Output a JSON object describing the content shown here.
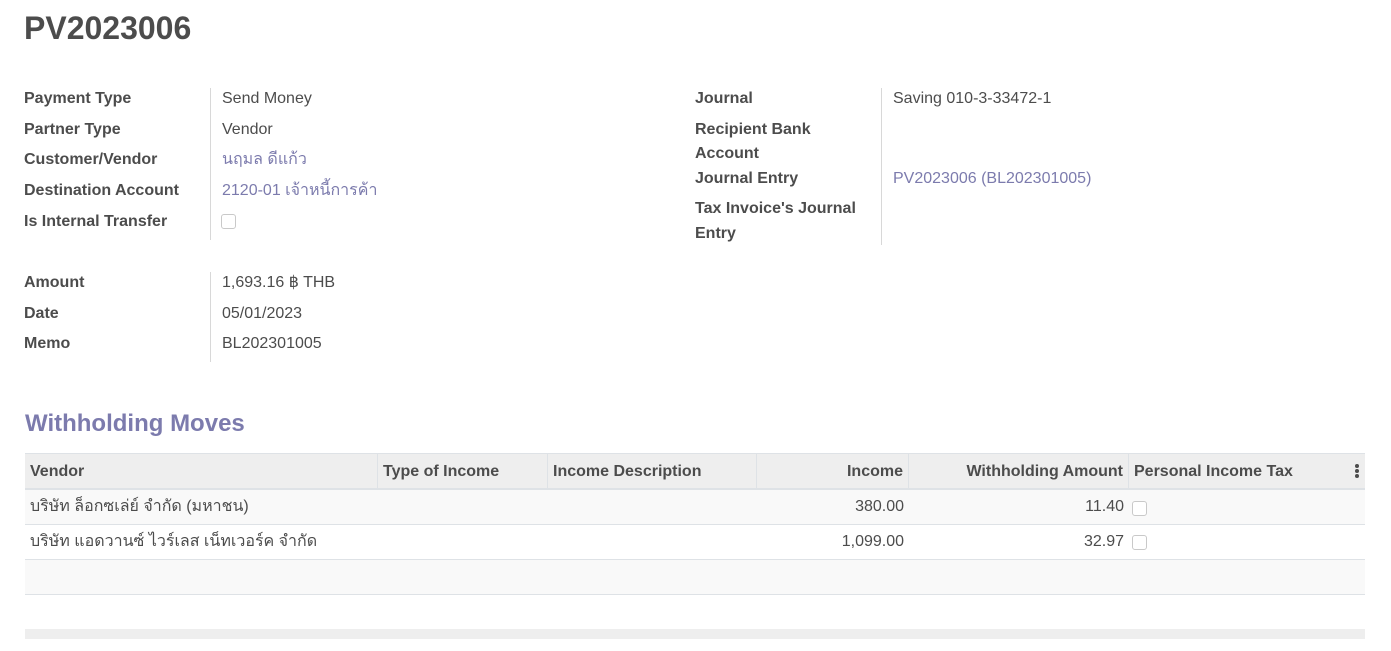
{
  "record": {
    "title": "PV2023006"
  },
  "left_group1": {
    "payment_type": {
      "label": "Payment Type",
      "value": "Send Money"
    },
    "partner_type": {
      "label": "Partner Type",
      "value": "Vendor"
    },
    "customer_vendor": {
      "label": "Customer/Vendor",
      "value": "นฤมล ดีแก้ว"
    },
    "destination_account": {
      "label": "Destination Account",
      "value": "2120-01 เจ้าหนี้การค้า"
    },
    "is_internal_transfer": {
      "label": "Is Internal Transfer",
      "checked": false
    }
  },
  "left_group2": {
    "amount": {
      "label": "Amount",
      "value": "1,693.16 ฿ THB"
    },
    "date": {
      "label": "Date",
      "value": "05/01/2023"
    },
    "memo": {
      "label": "Memo",
      "value": "BL202301005"
    }
  },
  "right_group": {
    "journal": {
      "label": "Journal",
      "value": "Saving 010-3-33472-1"
    },
    "recipient_bank_account": {
      "label_line1": "Recipient Bank",
      "label_line2": "Account",
      "value": ""
    },
    "journal_entry": {
      "label": "Journal Entry",
      "value": "PV2023006 (BL202301005)"
    },
    "tax_invoice_journal_entry": {
      "label_line1": "Tax Invoice's Journal",
      "label_line2": "Entry",
      "value": ""
    }
  },
  "withholding": {
    "title": "Withholding Moves",
    "columns": [
      "Vendor",
      "Type of Income",
      "Income Description",
      "Income",
      "Withholding Amount",
      "Personal Income Tax"
    ],
    "rows": [
      {
        "vendor": "บริษัท ล็อกซเล่ย์ จำกัด (มหาชน)",
        "type_of_income": "",
        "income_description": "",
        "income": "380.00",
        "withholding_amount": "11.40",
        "personal_income_tax": false
      },
      {
        "vendor": "บริษัท แอดวานซ์ ไวร์เลส เน็ทเวอร์ค จำกัด",
        "type_of_income": "",
        "income_description": "",
        "income": "1,099.00",
        "withholding_amount": "32.97",
        "personal_income_tax": false
      }
    ]
  },
  "icons": {
    "kebab": "kebab-vertical-icon"
  },
  "colors": {
    "link": "#7c7bad",
    "text": "#4c4c4c",
    "header_bg": "#eeeeee"
  }
}
